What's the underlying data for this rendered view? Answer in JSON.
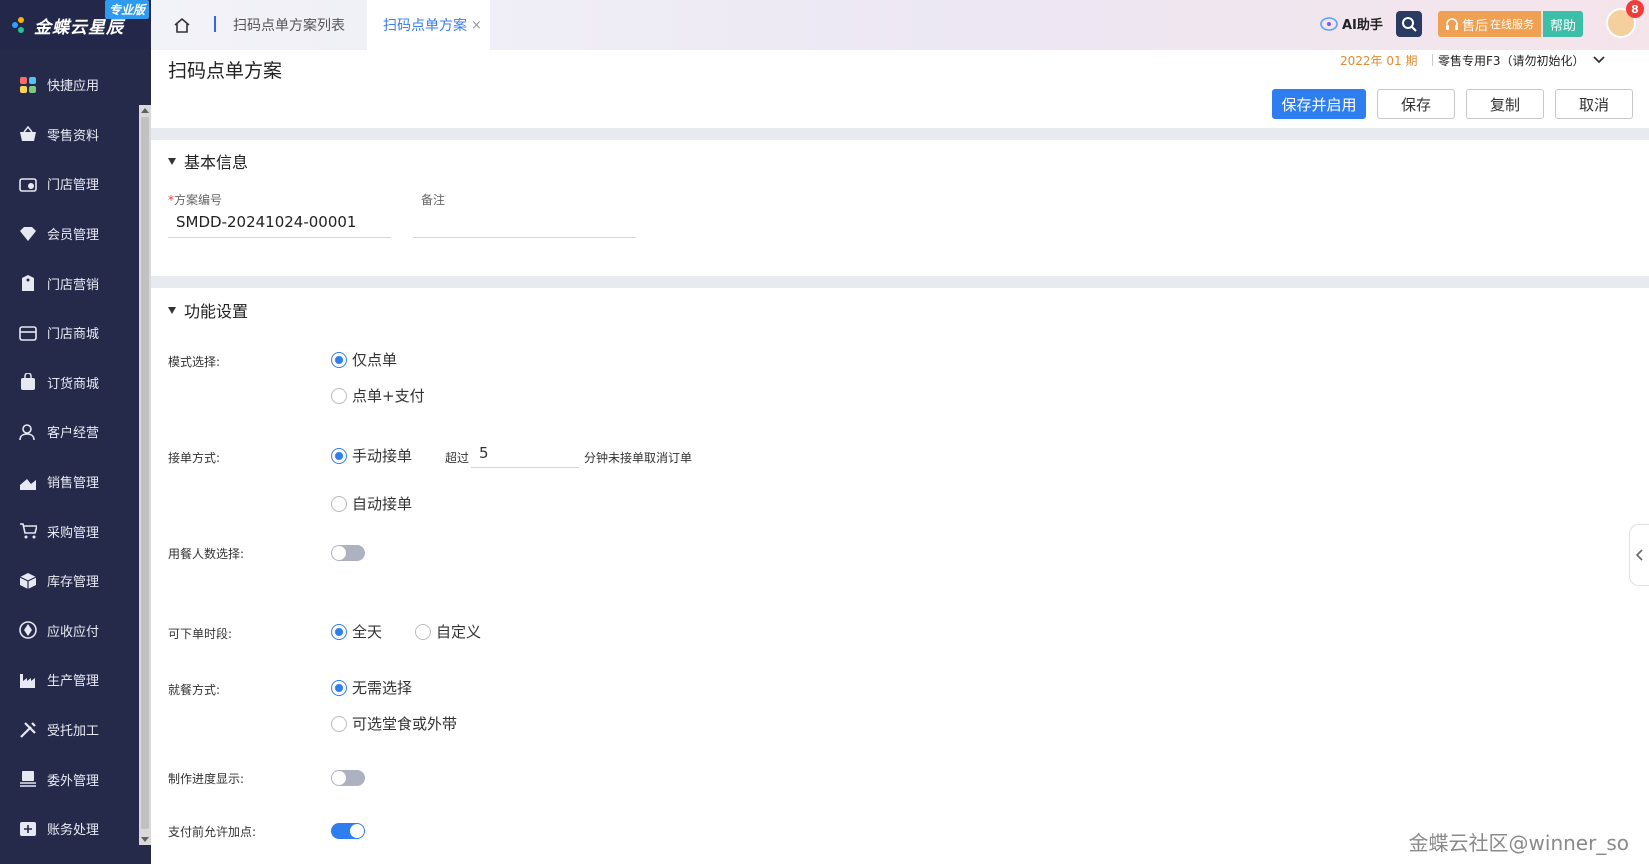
{
  "brand": {
    "name": "金蝶云星辰",
    "edition": "专业版"
  },
  "sidebar": {
    "items": [
      {
        "label": "快捷应用",
        "icon": "grid-apps-icon"
      },
      {
        "label": "零售资料",
        "icon": "basket-icon"
      },
      {
        "label": "门店管理",
        "icon": "store-icon"
      },
      {
        "label": "会员管理",
        "icon": "diamond-icon"
      },
      {
        "label": "门店营销",
        "icon": "tag-icon"
      },
      {
        "label": "门店商城",
        "icon": "shop-icon"
      },
      {
        "label": "订货商城",
        "icon": "bag-icon"
      },
      {
        "label": "客户经营",
        "icon": "user-icon"
      },
      {
        "label": "销售管理",
        "icon": "chart-up-icon"
      },
      {
        "label": "采购管理",
        "icon": "cart-icon"
      },
      {
        "label": "库存管理",
        "icon": "box-icon"
      },
      {
        "label": "应收应付",
        "icon": "coin-icon"
      },
      {
        "label": "生产管理",
        "icon": "factory-icon"
      },
      {
        "label": "受托加工",
        "icon": "tools-icon"
      },
      {
        "label": "委外管理",
        "icon": "stack-icon"
      },
      {
        "label": "账务处理",
        "icon": "ledger-icon"
      }
    ]
  },
  "topbar": {
    "tabs": [
      {
        "label": "扫码点单方案列表"
      },
      {
        "label": "扫码点单方案",
        "close": "×"
      }
    ],
    "ai_label": "AI助手",
    "service_label": "售后",
    "service_sub": "在线服务",
    "help_label": "帮助",
    "notification_count": "8"
  },
  "header": {
    "title": "扫码点单方案",
    "period": "2022年 01 期",
    "org": "零售专用F3（请勿初始化）"
  },
  "toolbar": {
    "save_enable": "保存并启用",
    "save": "保存",
    "copy": "复制",
    "cancel": "取消"
  },
  "basic": {
    "title": "基本信息",
    "code_label": "方案编号",
    "code_required": "*",
    "code_value": "SMDD-20241024-00001",
    "remark_label": "备注",
    "remark_value": ""
  },
  "settings": {
    "title": "功能设置",
    "mode": {
      "label": "模式选择:",
      "options": [
        "仅点单",
        "点单+支付"
      ],
      "selected": 0
    },
    "accept": {
      "label": "接单方式:",
      "options": [
        "手动接单",
        "自动接单"
      ],
      "selected": 0,
      "timeout_prefix": "超过",
      "timeout_value": "5",
      "timeout_suffix": "分钟未接单取消订单"
    },
    "diners": {
      "label": "用餐人数选择:",
      "on": false
    },
    "time": {
      "label": "可下单时段:",
      "options": [
        "全天",
        "自定义"
      ],
      "selected": 0
    },
    "dining": {
      "label": "就餐方式:",
      "options": [
        "无需选择",
        "可选堂食或外带"
      ],
      "selected": 0
    },
    "progress": {
      "label": "制作进度显示:",
      "on": false
    },
    "addon": {
      "label": "支付前允许加点:",
      "on": true
    }
  },
  "watermark": "金蝶云社区@winner_so",
  "colors": {
    "sidebar_bg": "#262a4a",
    "primary": "#2f7ef0",
    "period": "#e38b32",
    "service": "#f0a052",
    "help": "#3bbfa9"
  }
}
